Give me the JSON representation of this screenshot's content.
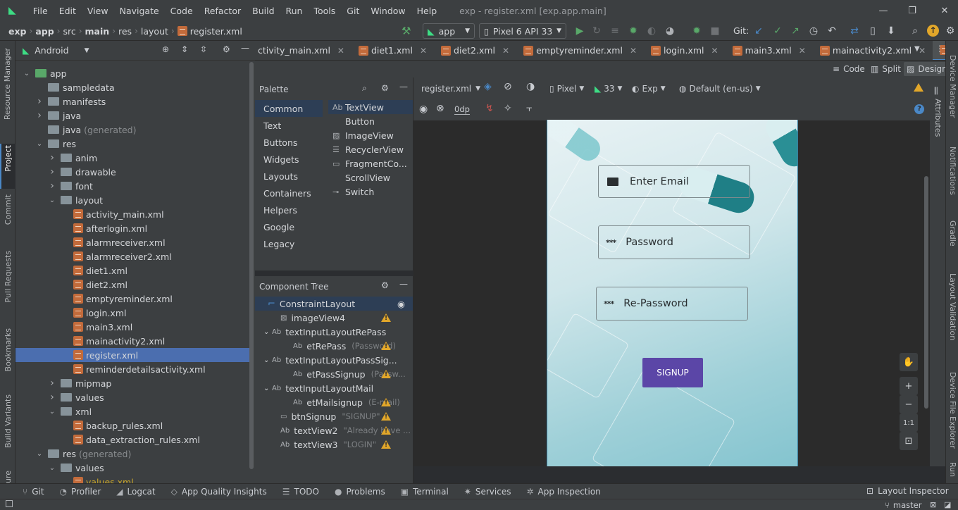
{
  "menu": [
    "File",
    "Edit",
    "View",
    "Navigate",
    "Code",
    "Refactor",
    "Build",
    "Run",
    "Tools",
    "Git",
    "Window",
    "Help"
  ],
  "window_title": "exp - register.xml [exp.app.main]",
  "breadcrumb": [
    "exp",
    "app",
    "src",
    "main",
    "res",
    "layout",
    "register.xml"
  ],
  "run_config": "app",
  "device": "Pixel 6 API 33",
  "git_label": "Git:",
  "project_view": "Android",
  "tree": [
    {
      "label": "app",
      "indent": 0,
      "arrow": "open",
      "icon": "module"
    },
    {
      "label": "sampledata",
      "indent": 1,
      "arrow": "",
      "icon": "folder"
    },
    {
      "label": "manifests",
      "indent": 1,
      "arrow": "closed",
      "icon": "folder"
    },
    {
      "label": "java",
      "indent": 1,
      "arrow": "closed",
      "icon": "folder"
    },
    {
      "label": "java (generated)",
      "indent": 1,
      "arrow": "",
      "icon": "folder-gen"
    },
    {
      "label": "res",
      "indent": 1,
      "arrow": "open",
      "icon": "folder-res"
    },
    {
      "label": "anim",
      "indent": 2,
      "arrow": "closed",
      "icon": "folder"
    },
    {
      "label": "drawable",
      "indent": 2,
      "arrow": "closed",
      "icon": "folder"
    },
    {
      "label": "font",
      "indent": 2,
      "arrow": "closed",
      "icon": "folder"
    },
    {
      "label": "layout",
      "indent": 2,
      "arrow": "open",
      "icon": "folder"
    },
    {
      "label": "activity_main.xml",
      "indent": 3,
      "arrow": "",
      "icon": "xml"
    },
    {
      "label": "afterlogin.xml",
      "indent": 3,
      "arrow": "",
      "icon": "xml"
    },
    {
      "label": "alarmreceiver.xml",
      "indent": 3,
      "arrow": "",
      "icon": "xml"
    },
    {
      "label": "alarmreceiver2.xml",
      "indent": 3,
      "arrow": "",
      "icon": "xml"
    },
    {
      "label": "diet1.xml",
      "indent": 3,
      "arrow": "",
      "icon": "xml"
    },
    {
      "label": "diet2.xml",
      "indent": 3,
      "arrow": "",
      "icon": "xml"
    },
    {
      "label": "emptyreminder.xml",
      "indent": 3,
      "arrow": "",
      "icon": "xml"
    },
    {
      "label": "login.xml",
      "indent": 3,
      "arrow": "",
      "icon": "xml"
    },
    {
      "label": "main3.xml",
      "indent": 3,
      "arrow": "",
      "icon": "xml"
    },
    {
      "label": "mainactivity2.xml",
      "indent": 3,
      "arrow": "",
      "icon": "xml"
    },
    {
      "label": "register.xml",
      "indent": 3,
      "arrow": "",
      "icon": "xml",
      "selected": true
    },
    {
      "label": "reminderdetailsactivity.xml",
      "indent": 3,
      "arrow": "",
      "icon": "xml"
    },
    {
      "label": "mipmap",
      "indent": 2,
      "arrow": "closed",
      "icon": "folder"
    },
    {
      "label": "values",
      "indent": 2,
      "arrow": "closed",
      "icon": "folder"
    },
    {
      "label": "xml",
      "indent": 2,
      "arrow": "open",
      "icon": "folder"
    },
    {
      "label": "backup_rules.xml",
      "indent": 3,
      "arrow": "",
      "icon": "xml"
    },
    {
      "label": "data_extraction_rules.xml",
      "indent": 3,
      "arrow": "",
      "icon": "xml"
    },
    {
      "label": "res (generated)",
      "indent": 1,
      "arrow": "open",
      "icon": "folder-res"
    },
    {
      "label": "values",
      "indent": 2,
      "arrow": "open",
      "icon": "folder"
    },
    {
      "label": "values.xml",
      "indent": 3,
      "arrow": "",
      "icon": "xml",
      "color": "#c8a52a"
    }
  ],
  "tabs": [
    {
      "label": "ctivity_main.xml"
    },
    {
      "label": "diet1.xml"
    },
    {
      "label": "diet2.xml"
    },
    {
      "label": "emptyreminder.xml"
    },
    {
      "label": "login.xml"
    },
    {
      "label": "main3.xml"
    },
    {
      "label": "mainactivity2.xml"
    },
    {
      "label": "register.xml",
      "active": true
    }
  ],
  "view_modes": [
    "Code",
    "Split",
    "Design"
  ],
  "palette": {
    "title": "Palette",
    "categories": [
      "Common",
      "Text",
      "Buttons",
      "Widgets",
      "Layouts",
      "Containers",
      "Helpers",
      "Google",
      "Legacy"
    ],
    "items": [
      {
        "icon": "Ab",
        "label": "TextView"
      },
      {
        "icon": "",
        "label": "Button"
      },
      {
        "icon": "img",
        "label": "ImageView"
      },
      {
        "icon": "list",
        "label": "RecyclerView"
      },
      {
        "icon": "frag",
        "label": "FragmentCo..."
      },
      {
        "icon": "",
        "label": "ScrollView"
      },
      {
        "icon": "sw",
        "label": "Switch"
      }
    ]
  },
  "component_tree": {
    "title": "Component Tree",
    "rows": [
      {
        "label": "ConstraintLayout",
        "hint": "",
        "indent": 0,
        "arrow": "",
        "warn": false,
        "selected": true
      },
      {
        "label": "imageView4",
        "hint": "",
        "indent": 1,
        "arrow": "",
        "warn": true
      },
      {
        "label": "textInputLayoutRePass",
        "hint": "",
        "indent": 1,
        "arrow": "open",
        "warn": false
      },
      {
        "label": "etRePass",
        "hint": "(Password)",
        "indent": 2,
        "arrow": "",
        "warn": true
      },
      {
        "label": "textInputLayoutPassSig...",
        "hint": "",
        "indent": 1,
        "arrow": "open",
        "warn": false
      },
      {
        "label": "etPassSignup",
        "hint": "(Passw...",
        "indent": 2,
        "arrow": "",
        "warn": true
      },
      {
        "label": "textInputLayoutMail",
        "hint": "",
        "indent": 1,
        "arrow": "open",
        "warn": false
      },
      {
        "label": "etMailsignup",
        "hint": "(E-mail)",
        "indent": 2,
        "arrow": "",
        "warn": true
      },
      {
        "label": "btnSignup",
        "hint": "\"SIGNUP\"",
        "indent": 1,
        "arrow": "",
        "warn": true
      },
      {
        "label": "textView2",
        "hint": "\"Already have ...",
        "indent": 1,
        "arrow": "",
        "warn": true
      },
      {
        "label": "textView3",
        "hint": "\"LOGIN\"",
        "indent": 1,
        "arrow": "",
        "warn": true
      }
    ]
  },
  "design_toolbar": {
    "file": "register.xml",
    "device": "Pixel",
    "api": "33",
    "theme": "Exp",
    "locale": "Default (en-us)",
    "margin": "0dp"
  },
  "preview": {
    "email": "Enter Email",
    "password": "Password",
    "repassword": "Re-Password",
    "signup": "SIGNUP"
  },
  "left_tools": [
    "Resource Manager",
    "Project",
    "Commit",
    "Pull Requests",
    "Bookmarks",
    "Build Variants",
    "ure"
  ],
  "right_tools": [
    "Device Manager",
    "Notifications",
    "Gradle",
    "Layout Validation",
    "Device File Explorer",
    "Run"
  ],
  "attributes_label": "Attributes",
  "bottom_tools": [
    {
      "icon": "⑂",
      "label": "Git"
    },
    {
      "icon": "◔",
      "label": "Profiler"
    },
    {
      "icon": "◢",
      "label": "Logcat"
    },
    {
      "icon": "◇",
      "label": "App Quality Insights"
    },
    {
      "icon": "☰",
      "label": "TODO"
    },
    {
      "icon": "●",
      "label": "Problems"
    },
    {
      "icon": "▣",
      "label": "Terminal"
    },
    {
      "icon": "✷",
      "label": "Services"
    },
    {
      "icon": "✲",
      "label": "App Inspection"
    }
  ],
  "layout_inspector": "Layout Inspector",
  "branch": "master",
  "colors": {
    "accent": "#4a88c7",
    "selection": "#4b6eaf",
    "signup_button": "#5b46a7",
    "warning": "#e2a72a",
    "run_green": "#59a869"
  }
}
